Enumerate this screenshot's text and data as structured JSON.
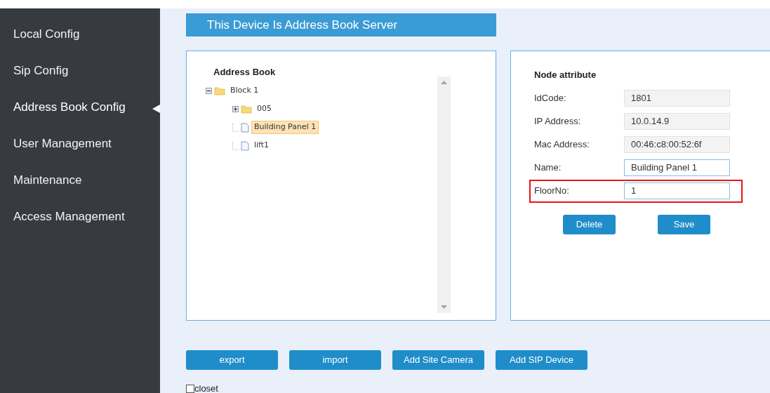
{
  "sidebar": {
    "items": [
      {
        "label": "Local Config",
        "selected": false
      },
      {
        "label": "Sip Config",
        "selected": false
      },
      {
        "label": "Address Book Config",
        "selected": true
      },
      {
        "label": "User Management",
        "selected": false
      },
      {
        "label": "Maintenance",
        "selected": false
      },
      {
        "label": "Access Management",
        "selected": false
      }
    ]
  },
  "header": "This Device Is Address Book Server",
  "tree": {
    "title": "Address Book",
    "nodes": [
      {
        "label": "Block 1",
        "kind": "folder",
        "expanded": true,
        "selected": false,
        "children": [
          {
            "label": "005",
            "kind": "folder",
            "expanded": false,
            "selected": false
          },
          {
            "label": "Building Panel 1",
            "kind": "file",
            "selected": true
          },
          {
            "label": "lift1",
            "kind": "file",
            "selected": false
          }
        ]
      }
    ]
  },
  "attributes": {
    "title": "Node attribute",
    "fields": [
      {
        "label": "IdCode:",
        "value": "1801",
        "disabled": true,
        "highlighted": false
      },
      {
        "label": "IP Address:",
        "value": "10.0.14.9",
        "disabled": true,
        "highlighted": false
      },
      {
        "label": "Mac Address:",
        "value": "00:46:c8:00:52:6f",
        "disabled": true,
        "highlighted": false
      },
      {
        "label": "Name:",
        "value": "Building Panel 1",
        "disabled": false,
        "highlighted": false
      },
      {
        "label": "FloorNo:",
        "value": "1",
        "disabled": false,
        "highlighted": true
      }
    ],
    "buttons": [
      "Delete",
      "Save"
    ]
  },
  "actions": [
    "export",
    "import",
    "Add Site Camera",
    "Add SIP Device"
  ],
  "closet": {
    "label": "closet",
    "checked": false
  }
}
